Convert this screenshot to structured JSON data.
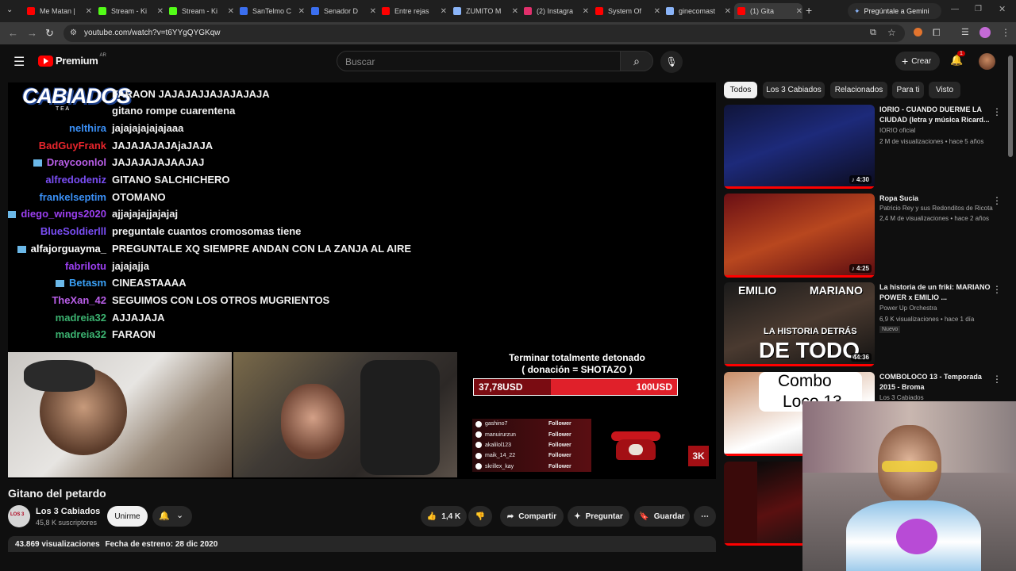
{
  "browser": {
    "tabs": [
      {
        "label": "Me Matan |",
        "color": "#ff0000"
      },
      {
        "label": "Stream - Ki",
        "color": "#53fc18"
      },
      {
        "label": "Stream - Ki",
        "color": "#53fc18"
      },
      {
        "label": "SanTelmo C",
        "color": "#3b6ff0"
      },
      {
        "label": "Senador D",
        "color": "#3b6ff0"
      },
      {
        "label": "Entre rejas",
        "color": "#ff0000"
      },
      {
        "label": "ZUMITO M",
        "color": "#8ab4f8"
      },
      {
        "label": "(2) Instagra",
        "color": "#e1306c"
      },
      {
        "label": "System Of",
        "color": "#ff0000"
      },
      {
        "label": "ginecomast",
        "color": "#8ab4f8"
      },
      {
        "label": "(1) Gita",
        "color": "#ff0000"
      }
    ],
    "gemini_label": "Pregúntale a Gemini",
    "url": "youtube.com/watch?v=t6YYgQYGKqw"
  },
  "header": {
    "logo": "Premium",
    "country": "AR",
    "search_placeholder": "Buscar",
    "create_label": "Crear",
    "notif_count": "1"
  },
  "stream": {
    "logo_text": "CABIADOS",
    "logo_sub": "T E A",
    "chat": [
      {
        "user": "",
        "msg": "FARAON JAJAJAJJAJAJAJAJA",
        "color": "#ffffff",
        "badge": false
      },
      {
        "user": "",
        "msg": "gitano rompe cuarentena",
        "color": "#ffffff",
        "badge": false
      },
      {
        "user": "nelthira",
        "msg": "jajajajajajajaaa",
        "color": "#3a8ff5",
        "badge": false
      },
      {
        "user": "BadGuyFrank",
        "msg": "JAJAJAJAJAjaJAJA",
        "color": "#e8252c",
        "badge": false
      },
      {
        "user": "Draycoonlol",
        "msg": "JAJAJAJAJAAJAJ",
        "color": "#b95ee8",
        "badge": true
      },
      {
        "user": "alfredodeniz",
        "msg": "GITANO SALCHICHERO",
        "color": "#7a4ef5",
        "badge": false
      },
      {
        "user": "frankelseptim",
        "msg": "OTOMANO",
        "color": "#3a8ff5",
        "badge": false
      },
      {
        "user": "diego_wings2020",
        "msg": "ajjajajajjajajaj",
        "color": "#9b3ff0",
        "badge": true
      },
      {
        "user": "BlueSoldierlll",
        "msg": "preguntale cuantos cromosomas tiene",
        "color": "#7a4ef5",
        "badge": false
      },
      {
        "user": "alfajorguayma_",
        "msg": "PREGUNTALE XQ SIEMPRE ANDAN CON LA ZANJA AL AIRE",
        "color": "#ffffff",
        "badge": true
      },
      {
        "user": "fabrilotu",
        "msg": "jajajajja",
        "color": "#9b3ff0",
        "badge": false
      },
      {
        "user": "Betasm",
        "msg": "CINEASTAAAA",
        "color": "#3aa0f5",
        "badge": true
      },
      {
        "user": "TheXan_42",
        "msg": "SEGUIMOS CON LOS OTROS MUGRIENTOS",
        "color": "#b95ee8",
        "badge": false
      },
      {
        "user": "madreia32",
        "msg": "AJJAJAJA",
        "color": "#3cb371",
        "badge": false
      },
      {
        "user": "madreia32",
        "msg": "FARAON",
        "color": "#3cb371",
        "badge": false
      }
    ],
    "goal_title_1": "Terminar totalmente detonado",
    "goal_title_2": "( donación = SHOTAZO )",
    "goal_current": "37,78USD",
    "goal_max": "100USD",
    "goal_fraction": 0.3778,
    "followers": [
      {
        "name": "gashino7",
        "tag": "Follower"
      },
      {
        "name": "manuirurzun",
        "tag": "Follower"
      },
      {
        "name": "akalilol123",
        "tag": "Follower"
      },
      {
        "name": "maik_14_22",
        "tag": "Follower"
      },
      {
        "name": "skrillex_kay",
        "tag": "Follower"
      }
    ],
    "counter": "3K"
  },
  "video": {
    "title": "Gitano del petardo",
    "channel": "Los 3 Cabiados",
    "subs": "45,8 K suscriptores",
    "join": "Unirme",
    "likes": "1,4 K",
    "share": "Compartir",
    "ask": "Preguntar",
    "save": "Guardar",
    "views": "43.869 visualizaciones",
    "premiere": "Fecha de estreno: 28 dic 2020"
  },
  "sidebar": {
    "chips": [
      "Todos",
      "Los 3 Cabiados",
      "Relacionados",
      "Para ti",
      "Visto"
    ],
    "recs": [
      {
        "title": "IORIO -  CUANDO DUERME LA CIUDAD (letra y música Ricard...",
        "channel": "IORIO oficial",
        "meta": "2 M de visualizaciones • hace 5 años",
        "duration": "♪ 4:30"
      },
      {
        "title": "Ropa Sucia",
        "channel": "Patricio Rey y sus Redonditos de Ricota",
        "meta": "2,4 M de visualizaciones • hace 2 años",
        "duration": "♪ 4:25"
      },
      {
        "title": "La historia de un friki: MARIANO POWER x EMILIO ...",
        "channel": "Power Up Orchestra",
        "meta": "6,9 K visualizaciones • hace 1 día",
        "duration": "44:36",
        "new": "Nuevo",
        "thumb_text_1": "EMILIO",
        "thumb_text_2": "MARIANO",
        "thumb_text_3": "LA HISTORIA DETRÁS",
        "thumb_text_4": "DE TODO"
      },
      {
        "title": "COMBOLOCO 13 - Temporada 2015 - Broma",
        "channel": "Los 3 Cabiados",
        "thumb_text_1": "Combo",
        "thumb_text_2": "Loco 13"
      }
    ]
  },
  "colors": {
    "accent": "#ff0000",
    "bg": "#0f0f0f"
  }
}
